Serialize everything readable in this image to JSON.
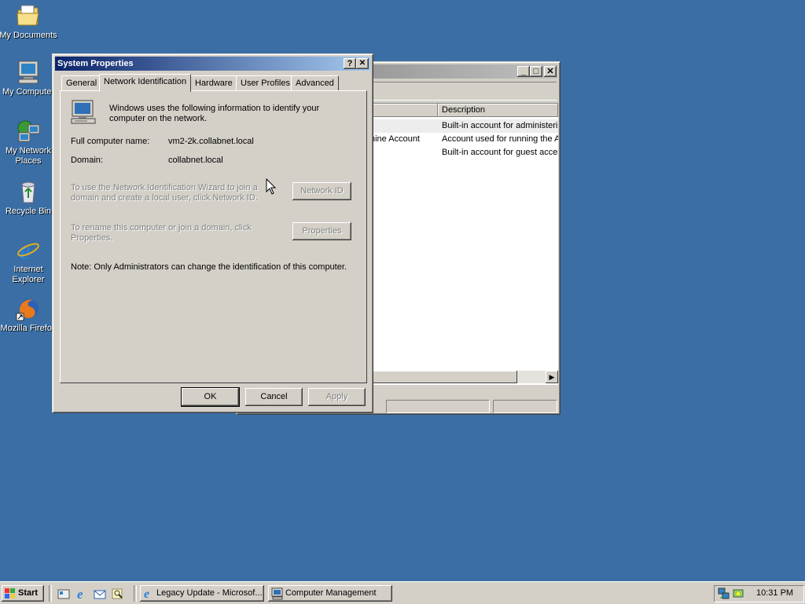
{
  "desktop": {
    "icons": [
      {
        "label": "My Documents"
      },
      {
        "label": "My Computer"
      },
      {
        "label": "My Network Places"
      },
      {
        "label": "Recycle Bin"
      },
      {
        "label": "Internet Explorer"
      },
      {
        "label": "Mozilla Firefox"
      }
    ]
  },
  "computer_management": {
    "list_header": {
      "description": "Description"
    },
    "rows": [
      {
        "name": "",
        "description": "Built-in account for administering"
      },
      {
        "name": "hine Account",
        "description": "Account used for running the A"
      },
      {
        "name": "",
        "description": "Built-in account for guest acces"
      }
    ]
  },
  "system_properties": {
    "title": "System Properties",
    "help_glyph": "?",
    "close_glyph": "✕",
    "tabs": [
      {
        "label": "General"
      },
      {
        "label": "Network Identification"
      },
      {
        "label": "Hardware"
      },
      {
        "label": "User Profiles"
      },
      {
        "label": "Advanced"
      }
    ],
    "intro": "Windows uses the following information to identify your computer on the network.",
    "full_name_label": "Full computer name:",
    "full_name_value": "vm2-2k.collabnet.local",
    "domain_label": "Domain:",
    "domain_value": "collabnet.local",
    "wizard_text": "To use the Network Identification Wizard to join a domain and create a local user, click Network ID.",
    "network_id_button": "Network ID",
    "rename_text": "To rename this computer or join a domain, click Properties.",
    "properties_button": "Properties",
    "note": "Note: Only Administrators can change the identification of this computer.",
    "ok_button": "OK",
    "cancel_button": "Cancel",
    "apply_button": "Apply"
  },
  "taskbar": {
    "start_label": "Start",
    "tasks": [
      {
        "label": "Legacy Update - Microsof..."
      },
      {
        "label": "Computer Management"
      }
    ],
    "clock": "10:31 PM"
  },
  "colors": {
    "desktop": "#3a6ea5",
    "title_active": "#0a246a",
    "face": "#d4d0c8"
  }
}
